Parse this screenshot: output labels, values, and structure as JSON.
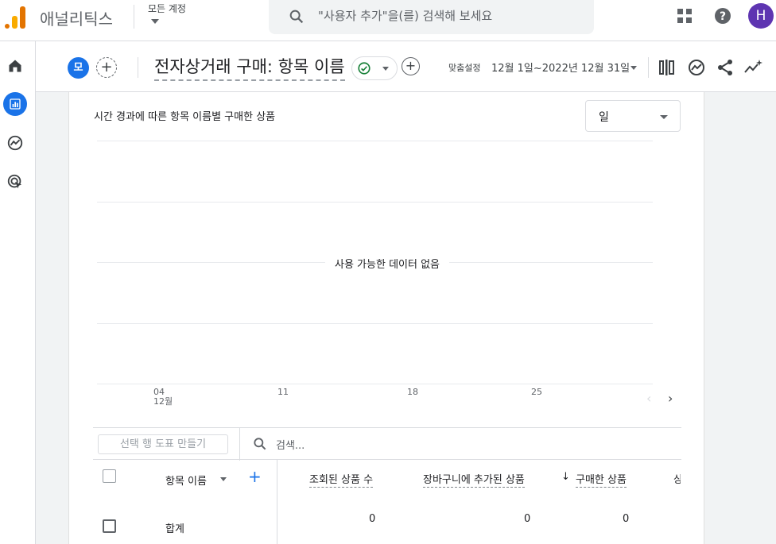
{
  "app": {
    "name": "애널리틱스",
    "account_label": "모든 계정",
    "search_placeholder": "\"사용자 추가\"을(를) 검색해 보세요",
    "avatar_initial": "H"
  },
  "report": {
    "segment_chip": "모",
    "title": "전자상거래 구매: 항목 이름",
    "date_label": "맞춤설정",
    "date_range": "12월 1일~2022년 12월 31일"
  },
  "chart": {
    "title": "시간 경과에 따른 항목 이름별 구매한 상품",
    "granularity": "일",
    "no_data": "사용 가능한 데이터 없음",
    "x_ticks": [
      {
        "day": "04",
        "month": "12월"
      },
      {
        "day": "11",
        "month": ""
      },
      {
        "day": "18",
        "month": ""
      },
      {
        "day": "25",
        "month": ""
      }
    ]
  },
  "chart_data": {
    "type": "line",
    "title": "시간 경과에 따른 항목 이름별 구매한 상품",
    "categories": [
      "04 12월",
      "11",
      "18",
      "25"
    ],
    "series": [],
    "annotation": "사용 가능한 데이터 없음"
  },
  "table": {
    "create_button": "선택 행 도표 만들기",
    "search_placeholder": "검색...",
    "dimension_header": "항목 이름",
    "columns": [
      "조회된 상품 수",
      "장바구니에 추가된 상품",
      "구매한 상품",
      "상"
    ],
    "sort_arrow": "↓",
    "total_label": "합계",
    "totals": [
      "0",
      "0",
      "0"
    ]
  },
  "colors": {
    "accent": "#1a73e8",
    "avatar": "#5e35b1",
    "logo_orange": "#f9ab00",
    "logo_dark": "#e37400",
    "check_green": "#188038"
  },
  "icons": {
    "search": "search-icon",
    "apps": "apps-grid-icon",
    "help": "help-icon",
    "home": "home-icon",
    "reports": "bar-chart-icon",
    "explore": "explore-icon",
    "advertising": "advertising-icon"
  }
}
